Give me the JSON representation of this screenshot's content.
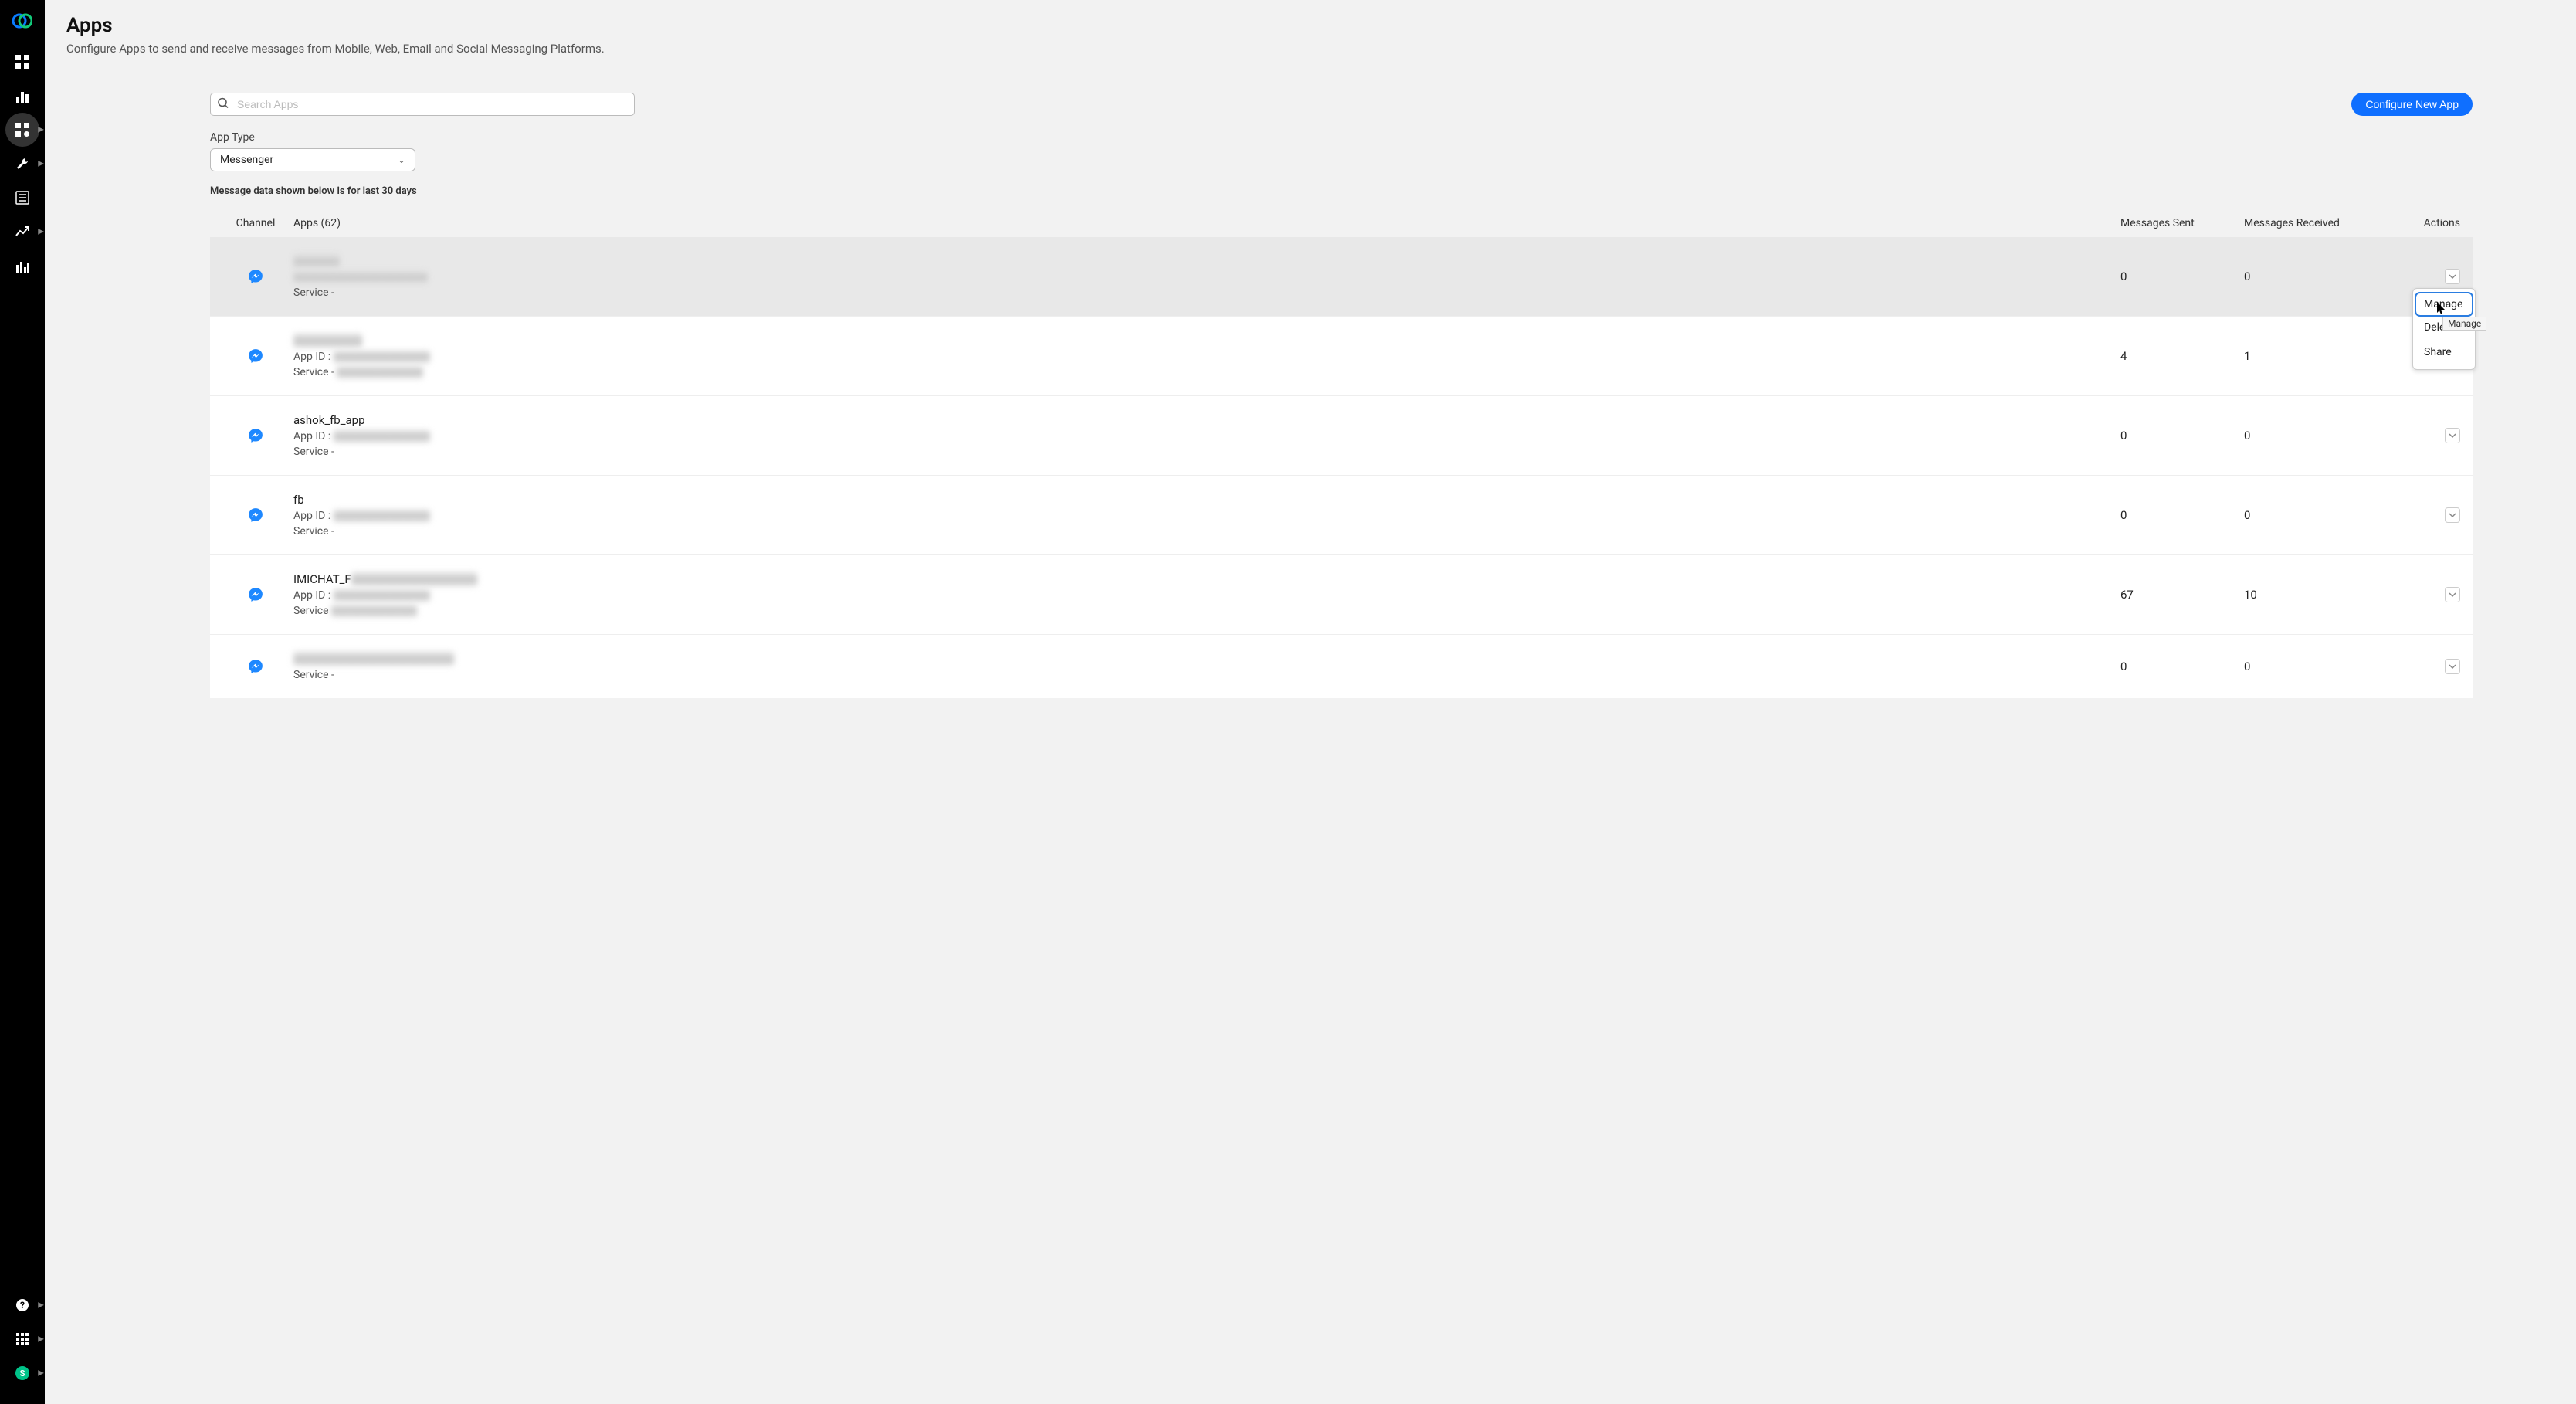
{
  "header": {
    "title": "Apps",
    "subtitle": "Configure Apps to send and receive messages from Mobile, Web, Email and Social Messaging Platforms."
  },
  "search": {
    "placeholder": "Search Apps",
    "value": ""
  },
  "configure_button": "Configure New App",
  "app_type": {
    "label": "App Type",
    "selected": "Messenger"
  },
  "table_note": "Message data shown below is for last 30 days",
  "columns": {
    "channel": "Channel",
    "apps": "Apps (62)",
    "sent": "Messages Sent",
    "received": "Messages Received",
    "actions": "Actions"
  },
  "rows": [
    {
      "name": "",
      "name_blur": true,
      "app_id_line": "",
      "app_id_blur": true,
      "service_line": "Service -",
      "service_blur": false,
      "sent": "0",
      "received": "0"
    },
    {
      "name": "",
      "name_blur": true,
      "app_id_line": "App ID :",
      "app_id_blur": true,
      "service_line": "Service -",
      "service_blur": true,
      "sent": "4",
      "received": "1"
    },
    {
      "name": "ashok_fb_app",
      "name_blur": false,
      "app_id_line": "App ID :",
      "app_id_blur": true,
      "service_line": "Service -",
      "service_blur": false,
      "sent": "0",
      "received": "0"
    },
    {
      "name": "fb",
      "name_blur": false,
      "app_id_line": "App ID :",
      "app_id_blur": true,
      "service_line": "Service -",
      "service_blur": false,
      "sent": "0",
      "received": "0"
    },
    {
      "name": "IMICHAT_F",
      "name_blur": false,
      "name_blur_after": true,
      "app_id_line": "App ID :",
      "app_id_blur": true,
      "service_line": "Service",
      "service_blur": true,
      "sent": "67",
      "received": "10"
    },
    {
      "name": "",
      "name_blur": true,
      "app_id_line": "",
      "app_id_blur": false,
      "service_line": "Service -",
      "service_blur": false,
      "sent": "0",
      "received": "0"
    }
  ],
  "dropdown": {
    "manage": "Manage",
    "delete": "Delet",
    "share": "Share",
    "tooltip": "Manage"
  },
  "avatar_letter": "S"
}
